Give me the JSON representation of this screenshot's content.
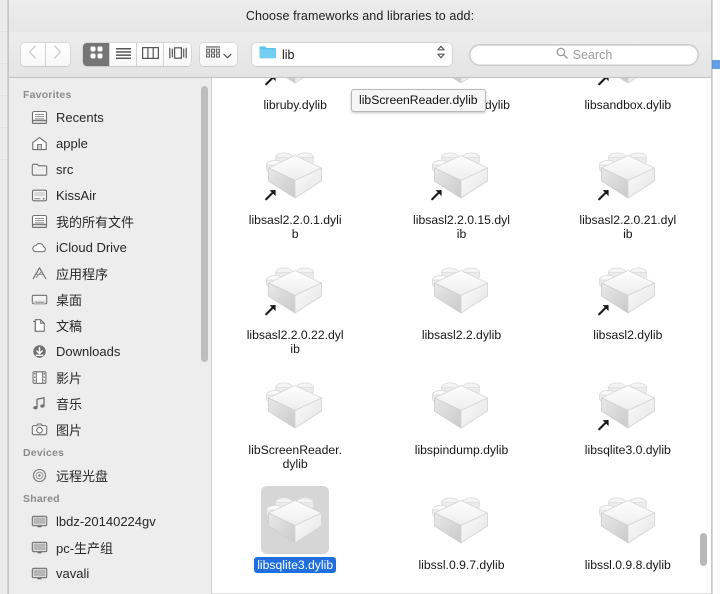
{
  "dialog": {
    "prompt": "Choose frameworks and libraries to add:"
  },
  "toolbar": {
    "back_button": "Back",
    "back_icon": "chevron-left-icon",
    "forward_button": "Forward",
    "forward_icon": "chevron-right-icon",
    "view_modes": [
      {
        "name": "icon-view",
        "icon": "grid-icon",
        "selected": true
      },
      {
        "name": "list-view",
        "icon": "list-icon",
        "selected": false
      },
      {
        "name": "column-view",
        "icon": "columns-icon",
        "selected": false
      },
      {
        "name": "gallery-view",
        "icon": "coverflow-icon",
        "selected": false
      }
    ],
    "arrange_button": "Arrange",
    "arrange_icon": "arrange-icon",
    "arrange_chevron_icon": "chevron-down-icon",
    "path": {
      "folder_icon": "folder-icon",
      "name": "lib",
      "stepper_icon": "up-down-stepper-icon"
    },
    "search": {
      "icon": "search-icon",
      "placeholder": "Search",
      "value": ""
    }
  },
  "sidebar": {
    "sections": [
      {
        "header": "Favorites",
        "items": [
          {
            "label": "Recents",
            "icon": "recents-icon",
            "cjk": false
          },
          {
            "label": "apple",
            "icon": "home-icon",
            "cjk": false
          },
          {
            "label": "src",
            "icon": "folder-icon",
            "cjk": false
          },
          {
            "label": "KissAir",
            "icon": "harddisk-icon",
            "cjk": false
          },
          {
            "label": "我的所有文件",
            "icon": "allfiles-icon",
            "cjk": true
          },
          {
            "label": "iCloud Drive",
            "icon": "cloud-icon",
            "cjk": false
          },
          {
            "label": "应用程序",
            "icon": "apps-icon",
            "cjk": true
          },
          {
            "label": "桌面",
            "icon": "desktop-icon",
            "cjk": true
          },
          {
            "label": "文稿",
            "icon": "documents-icon",
            "cjk": true
          },
          {
            "label": "Downloads",
            "icon": "downloads-icon",
            "cjk": false
          },
          {
            "label": "影片",
            "icon": "movies-icon",
            "cjk": true
          },
          {
            "label": "音乐",
            "icon": "music-icon",
            "cjk": true
          },
          {
            "label": "图片",
            "icon": "pictures-icon",
            "cjk": true
          }
        ]
      },
      {
        "header": "Devices",
        "items": [
          {
            "label": "远程光盘",
            "icon": "disc-icon",
            "cjk": true
          }
        ]
      },
      {
        "header": "Shared",
        "items": [
          {
            "label": "lbdz-20140224gv",
            "icon": "display-icon",
            "cjk": false
          },
          {
            "label": "pc-生产组",
            "icon": "display-icon",
            "cjk": true
          },
          {
            "label": "vavali",
            "icon": "display-icon",
            "cjk": false
          }
        ]
      }
    ]
  },
  "files": {
    "icon": "dylib-brick-icon",
    "rows": [
      [
        {
          "name": "libruby.dylib",
          "alias": true,
          "selected": false
        },
        {
          "name": "libsandbox.1.dylib",
          "alias": false,
          "selected": false
        },
        {
          "name": "libsandbox.dylib",
          "alias": true,
          "selected": false
        }
      ],
      [
        {
          "name": "libsasl2.2.0.1.dylib",
          "alias": true,
          "selected": false
        },
        {
          "name": "libsasl2.2.0.15.dylib",
          "alias": true,
          "selected": false
        },
        {
          "name": "libsasl2.2.0.21.dylib",
          "alias": true,
          "selected": false
        }
      ],
      [
        {
          "name": "libsasl2.2.0.22.dylib",
          "alias": true,
          "selected": false
        },
        {
          "name": "libsasl2.2.dylib",
          "alias": false,
          "selected": false
        },
        {
          "name": "libsasl2.dylib",
          "alias": true,
          "selected": false
        }
      ],
      [
        {
          "name": "libScreenReader.dylib",
          "alias": false,
          "selected": false
        },
        {
          "name": "libspindump.dylib",
          "alias": false,
          "selected": false
        },
        {
          "name": "libsqlite3.0.dylib",
          "alias": true,
          "selected": false
        }
      ],
      [
        {
          "name": "libsqlite3.dylib",
          "alias": false,
          "selected": true
        },
        {
          "name": "libssl.0.9.7.dylib",
          "alias": false,
          "selected": false
        },
        {
          "name": "libssl.0.9.8.dylib",
          "alias": false,
          "selected": false
        }
      ]
    ],
    "tooltip": "libScreenReader.dylib"
  },
  "colors": {
    "selection_blue": "#1f6fe0",
    "selection_icon_gray": "#d6d6d6",
    "toolbar_selected": "#767676",
    "folder_blue": "#5cc3ef",
    "sidebar_bg": "#ededed"
  }
}
